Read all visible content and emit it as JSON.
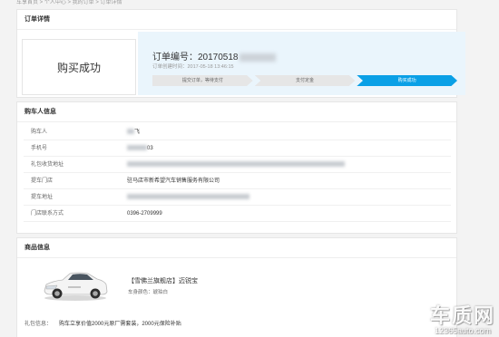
{
  "breadcrumb": "车享首页 > 个人中心 > 我的订单 > 订单详情",
  "order": {
    "section_title": "订单详情",
    "status": "购买成功",
    "number_prefix": "订单编号：20170518",
    "created_time": "订单创建时间：2017-05-18 13:46:15",
    "steps": [
      {
        "label": "提交订单，等待支付",
        "active": false
      },
      {
        "label": "支付定金",
        "active": false
      },
      {
        "label": "购买成功",
        "active": true
      }
    ]
  },
  "buyer": {
    "section_title": "购车人信息",
    "rows": [
      {
        "label": "购车人",
        "value": "飞"
      },
      {
        "label": "手机号",
        "value": "03"
      },
      {
        "label": "礼包收货地址",
        "value": ""
      },
      {
        "label": "提车门店",
        "value": "驻马店市新希望汽车销售服务有限公司"
      },
      {
        "label": "提车地址",
        "value": ""
      },
      {
        "label": "门店联系方式",
        "value": "0396-2709999"
      }
    ]
  },
  "goods": {
    "section_title": "商品信息",
    "name": "【雪佛兰旗舰店】迈锐宝",
    "color": "车身颜色：琥珀白",
    "gift_label": "礼包信息：",
    "gift_value": "购车立享价值2000元原厂需套装，2000元保险补贴"
  },
  "watermark": {
    "main": "车质网",
    "url": "12365auto.com"
  },
  "colors": {
    "accent": "#0aa0e6",
    "panel_bg": "#eaf5fc",
    "page_bg": "#f3f3f3"
  }
}
